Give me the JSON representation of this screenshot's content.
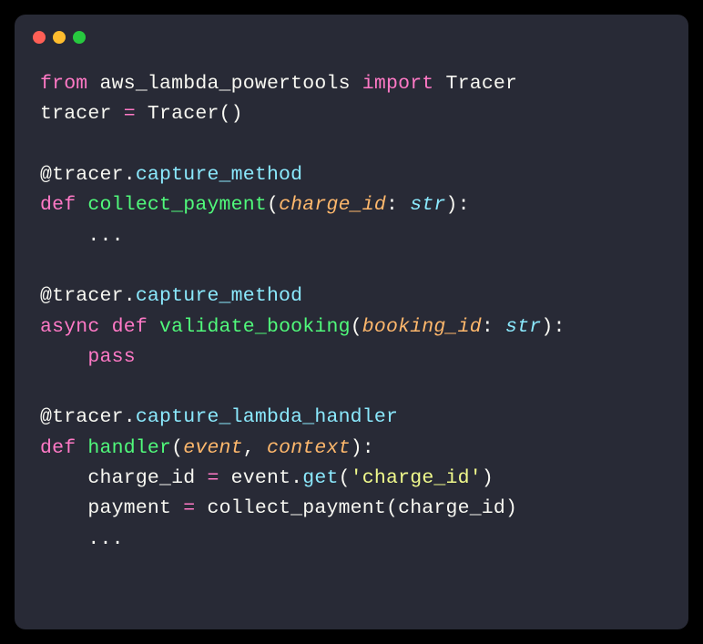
{
  "window": {
    "traffic_lights": {
      "close": "close",
      "minimize": "minimize",
      "maximize": "maximize"
    }
  },
  "code": {
    "l1": {
      "from": "from",
      "mod": " aws_lambda_powertools ",
      "imp": "import",
      "name": " Tracer"
    },
    "l2": {
      "var": "tracer ",
      "eq": "=",
      "call": " Tracer()"
    },
    "l4": {
      "at": "@tracer.",
      "method": "capture_method"
    },
    "l5": {
      "def": "def ",
      "name": "collect_payment",
      "lp": "(",
      "p1": "charge_id",
      "colon": ": ",
      "t1": "str",
      "rp": "):"
    },
    "l6": {
      "indent": "    ",
      "dots": "..."
    },
    "l8": {
      "at": "@tracer.",
      "method": "capture_method"
    },
    "l9": {
      "async": "async ",
      "def": "def ",
      "name": "validate_booking",
      "lp": "(",
      "p1": "booking_id",
      "colon": ": ",
      "t1": "str",
      "rp": "):"
    },
    "l10": {
      "indent": "    ",
      "pass": "pass"
    },
    "l12": {
      "at": "@tracer.",
      "method": "capture_lambda_handler"
    },
    "l13": {
      "def": "def ",
      "name": "handler",
      "lp": "(",
      "p1": "event",
      "comma": ", ",
      "p2": "context",
      "rp": "):"
    },
    "l14": {
      "indent": "    ",
      "var": "charge_id ",
      "eq": "=",
      "obj": " event.",
      "method": "get",
      "lp": "(",
      "str": "'charge_id'",
      "rp": ")"
    },
    "l15": {
      "indent": "    ",
      "var": "payment ",
      "eq": "=",
      "call": " collect_payment(charge_id)"
    },
    "l16": {
      "indent": "    ",
      "dots": "..."
    }
  }
}
